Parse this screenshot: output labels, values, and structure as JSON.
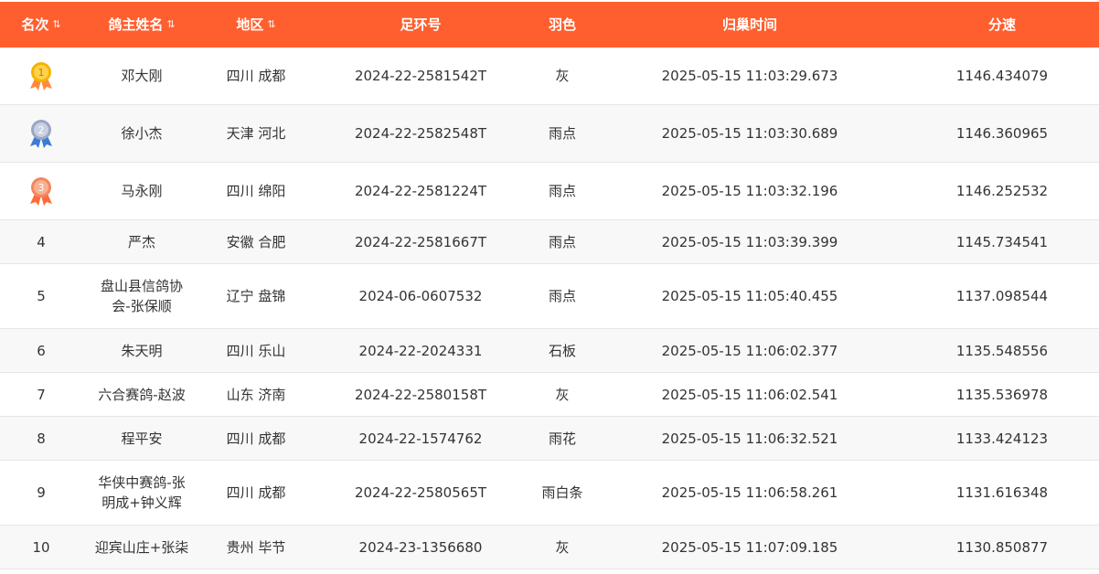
{
  "colors": {
    "header_bg": "#ff5f2e",
    "gold": "#f4b400",
    "silver": "#9aa6c4",
    "bronze": "#f2865e",
    "ribbon_gold": "#ff8a3d",
    "ribbon_silver": "#3a7bd5",
    "ribbon_bronze": "#ff6a3d"
  },
  "header": {
    "rank": "名次",
    "owner": "鸽主姓名",
    "region": "地区",
    "ring": "足环号",
    "color": "羽色",
    "time": "归巢时间",
    "speed": "分速",
    "sort_icon": "sort-icon"
  },
  "rows": [
    {
      "rank": "1",
      "medal": "gold",
      "owner": "邓大刚",
      "region": "四川 成都",
      "ring": "2024-22-2581542T",
      "color": "灰",
      "time": "2025-05-15 11:03:29.673",
      "speed": "1146.434079"
    },
    {
      "rank": "2",
      "medal": "silver",
      "owner": "徐小杰",
      "region": "天津 河北",
      "ring": "2024-22-2582548T",
      "color": "雨点",
      "time": "2025-05-15 11:03:30.689",
      "speed": "1146.360965"
    },
    {
      "rank": "3",
      "medal": "bronze",
      "owner": "马永刚",
      "region": "四川 绵阳",
      "ring": "2024-22-2581224T",
      "color": "雨点",
      "time": "2025-05-15 11:03:32.196",
      "speed": "1146.252532"
    },
    {
      "rank": "4",
      "owner": "严杰",
      "region": "安徽 合肥",
      "ring": "2024-22-2581667T",
      "color": "雨点",
      "time": "2025-05-15 11:03:39.399",
      "speed": "1145.734541"
    },
    {
      "rank": "5",
      "owner_line1": "盘山县信鸽协",
      "owner_line2": "会-张保顺",
      "region": "辽宁 盘锦",
      "ring": "2024-06-0607532",
      "color": "雨点",
      "time": "2025-05-15 11:05:40.455",
      "speed": "1137.098544"
    },
    {
      "rank": "6",
      "owner": "朱天明",
      "region": "四川 乐山",
      "ring": "2024-22-2024331",
      "color": "石板",
      "time": "2025-05-15 11:06:02.377",
      "speed": "1135.548556"
    },
    {
      "rank": "7",
      "owner": "六合赛鸽-赵波",
      "region": "山东 济南",
      "ring": "2024-22-2580158T",
      "color": "灰",
      "time": "2025-05-15 11:06:02.541",
      "speed": "1135.536978"
    },
    {
      "rank": "8",
      "owner": "程平安",
      "region": "四川 成都",
      "ring": "2024-22-1574762",
      "color": "雨花",
      "time": "2025-05-15 11:06:32.521",
      "speed": "1133.424123"
    },
    {
      "rank": "9",
      "owner_line1": "华侠中赛鸽-张",
      "owner_line2": "明成+钟义辉",
      "region": "四川 成都",
      "ring": "2024-22-2580565T",
      "color": "雨白条",
      "time": "2025-05-15 11:06:58.261",
      "speed": "1131.616348"
    },
    {
      "rank": "10",
      "owner": "迎宾山庄+张柒",
      "region": "贵州 毕节",
      "ring": "2024-23-1356680",
      "color": "灰",
      "time": "2025-05-15 11:07:09.185",
      "speed": "1130.850877"
    }
  ]
}
